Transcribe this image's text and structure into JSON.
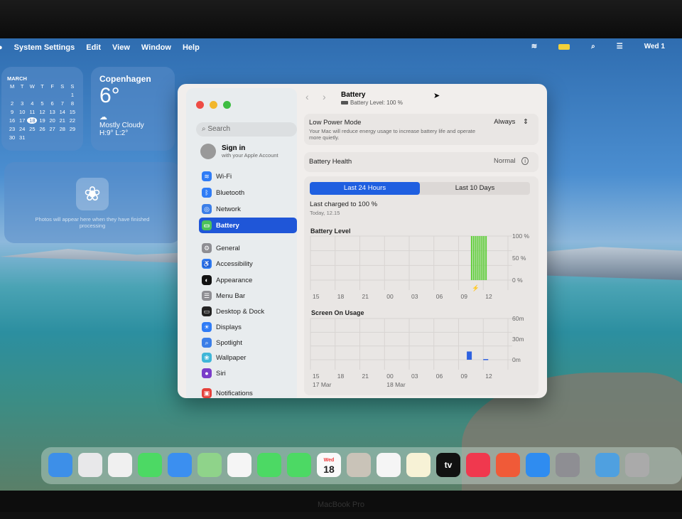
{
  "menubar": {
    "app": "System Settings",
    "items": [
      "Edit",
      "View",
      "Window",
      "Help"
    ],
    "clock": "Wed 1"
  },
  "calendar": {
    "month": "MARCH",
    "weekdays": [
      "M",
      "T",
      "W",
      "T",
      "F",
      "S",
      "S"
    ],
    "weeks": [
      [
        "",
        "",
        "",
        "",
        "",
        "",
        "1"
      ],
      [
        "2",
        "3",
        "4",
        "5",
        "6",
        "7",
        "8"
      ],
      [
        "9",
        "10",
        "11",
        "12",
        "13",
        "14",
        "15"
      ],
      [
        "16",
        "17",
        "18",
        "19",
        "20",
        "21",
        "22"
      ],
      [
        "23",
        "24",
        "25",
        "26",
        "27",
        "28",
        "29"
      ],
      [
        "30",
        "31",
        "",
        "",
        "",
        "",
        ""
      ]
    ],
    "today": "18"
  },
  "weather": {
    "city": "Copenhagen",
    "temp": "6°",
    "condition": "Mostly Cloudy",
    "hilo": "H:9° L:2°"
  },
  "photos": {
    "message": "Photos will appear here when they have finished processing"
  },
  "sidebar": {
    "search_placeholder": "Search",
    "signin_title": "Sign in",
    "signin_sub": "with your Apple Account",
    "items": [
      {
        "label": "Wi-Fi",
        "color": "#2f7cf6",
        "glyph": "≋"
      },
      {
        "label": "Bluetooth",
        "color": "#2f7cf6",
        "glyph": "ᛒ"
      },
      {
        "label": "Network",
        "color": "#3b7ee8",
        "glyph": "◎"
      },
      {
        "label": "Battery",
        "color": "#4cc25a",
        "glyph": "▭"
      },
      {
        "label": "General",
        "color": "#8e8e93",
        "glyph": "⚙"
      },
      {
        "label": "Accessibility",
        "color": "#2f7cf6",
        "glyph": "♿"
      },
      {
        "label": "Appearance",
        "color": "#111",
        "glyph": "◐"
      },
      {
        "label": "Menu Bar",
        "color": "#8e8e93",
        "glyph": "☰"
      },
      {
        "label": "Desktop & Dock",
        "color": "#222",
        "glyph": "▭"
      },
      {
        "label": "Displays",
        "color": "#2f7cf6",
        "glyph": "☀"
      },
      {
        "label": "Spotlight",
        "color": "#3b7ee8",
        "glyph": "⌕"
      },
      {
        "label": "Wallpaper",
        "color": "#3fb6d8",
        "glyph": "❀"
      },
      {
        "label": "Siri",
        "color": "#7a3cc9",
        "glyph": "●"
      },
      {
        "label": "Notifications",
        "color": "#e5403a",
        "glyph": "▣"
      }
    ],
    "active": "Battery"
  },
  "header": {
    "title": "Battery",
    "subtitle": "Battery Level: 100 %"
  },
  "low_power": {
    "label": "Low Power Mode",
    "description": "Your Mac will reduce energy usage to increase battery life and operate more quietly.",
    "value": "Always"
  },
  "health": {
    "label": "Battery Health",
    "value": "Normal"
  },
  "tabs": [
    "Last 24 Hours",
    "Last 10 Days"
  ],
  "active_tab": "Last 24 Hours",
  "last_charged": {
    "label": "Last charged to 100 %",
    "time": "Today, 12.15"
  },
  "battery_chart": {
    "title": "Battery Level",
    "y_ticks": [
      "100 %",
      "50 %",
      "0 %"
    ],
    "x_ticks": [
      "15",
      "18",
      "21",
      "00",
      "03",
      "06",
      "09",
      "12"
    ],
    "ylim": [
      0,
      100
    ],
    "x_hours": [
      10.5,
      10.75,
      11,
      11.25,
      11.5,
      11.75,
      12,
      12.25
    ],
    "values": [
      100,
      100,
      100,
      100,
      100,
      100,
      100,
      100
    ],
    "charging": true,
    "color": "#5fcf3a"
  },
  "screen_chart": {
    "title": "Screen On Usage",
    "y_ticks": [
      "60m",
      "30m",
      "0m"
    ],
    "x_ticks": [
      "15",
      "18",
      "21",
      "00",
      "03",
      "06",
      "09",
      "12"
    ],
    "date_labels": [
      "17 Mar",
      "18 Mar"
    ],
    "ylim": [
      0,
      60
    ],
    "x_hours": [
      10,
      12
    ],
    "values": [
      12,
      1
    ],
    "color": "#2f62e0"
  },
  "dock": [
    {
      "name": "Finder",
      "color": "#3d8fe8"
    },
    {
      "name": "Launchpad",
      "color": "#e8e8ea"
    },
    {
      "name": "Safari",
      "color": "#f0f0f0"
    },
    {
      "name": "Messages",
      "color": "#4cd964"
    },
    {
      "name": "Mail",
      "color": "#3b8ff0"
    },
    {
      "name": "Maps",
      "color": "#8fd38a"
    },
    {
      "name": "Photos",
      "color": "#f5f5f5"
    },
    {
      "name": "FaceTime",
      "color": "#4cd964"
    },
    {
      "name": "Phone",
      "color": "#4cd964"
    },
    {
      "name": "Calendar",
      "color": "#fafafa",
      "day": "Wed",
      "date": "18"
    },
    {
      "name": "Contacts",
      "color": "#c9c3b8"
    },
    {
      "name": "Reminders",
      "color": "#f5f5f5"
    },
    {
      "name": "Notes",
      "color": "#f7f2d6"
    },
    {
      "name": "TV",
      "color": "#111",
      "label": "tv"
    },
    {
      "name": "Music",
      "color": "#f0384e"
    },
    {
      "name": "Rocket",
      "color": "#f05a38"
    },
    {
      "name": "App Store",
      "color": "#2f8cf0"
    },
    {
      "name": "System Settings",
      "color": "#8e8e93"
    },
    {
      "name": "Downloads",
      "color": "#4fa0e0"
    },
    {
      "name": "Trash",
      "color": "#aaa"
    }
  ],
  "bezel_label": "MacBook Pro"
}
